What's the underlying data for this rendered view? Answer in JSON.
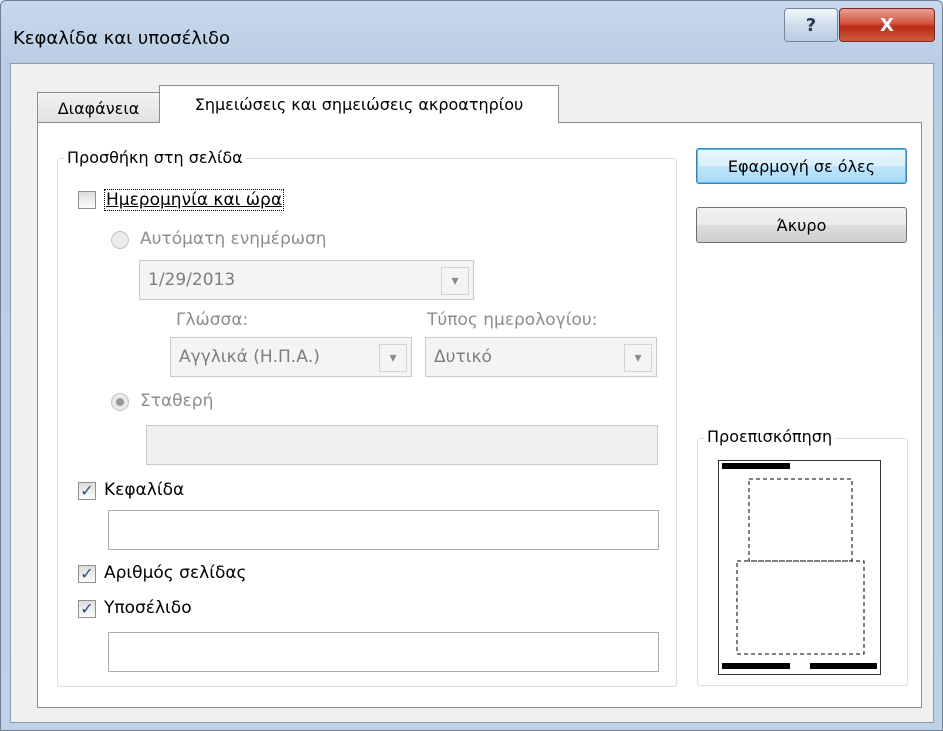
{
  "window": {
    "title": "Κεφαλίδα και υποσέλιδο",
    "help_glyph": "?",
    "close_glyph": "X"
  },
  "tabs": [
    {
      "label": "Διαφάνεια",
      "active": false
    },
    {
      "label": "Σημειώσεις και σημειώσεις ακροατηρίου",
      "active": true
    }
  ],
  "group_add": {
    "label": "Προσθήκη στη σελίδα"
  },
  "datetime": {
    "label": "Ημερομηνία και ώρα",
    "checked": false,
    "auto_update_label": "Αυτόματη ενημέρωση",
    "date_value": "1/29/2013",
    "language_label": "Γλώσσα:",
    "language_value": "Αγγλικά (Η.Π.Α.)",
    "calendar_label": "Τύπος ημερολογίου:",
    "calendar_value": "Δυτικό",
    "fixed_label": "Σταθερή",
    "fixed_value": ""
  },
  "header": {
    "label": "Κεφαλίδα",
    "checked": true,
    "value": ""
  },
  "page_number": {
    "label": "Αριθμός σελίδας",
    "checked": true
  },
  "footer": {
    "label": "Υποσέλιδο",
    "checked": true,
    "value": ""
  },
  "buttons": {
    "apply_all": "Εφαρμογή σε όλες",
    "cancel": "Άκυρο"
  },
  "preview": {
    "label": "Προεπισκόπηση"
  },
  "check_glyph": "✓",
  "arrow_glyph": "▾"
}
